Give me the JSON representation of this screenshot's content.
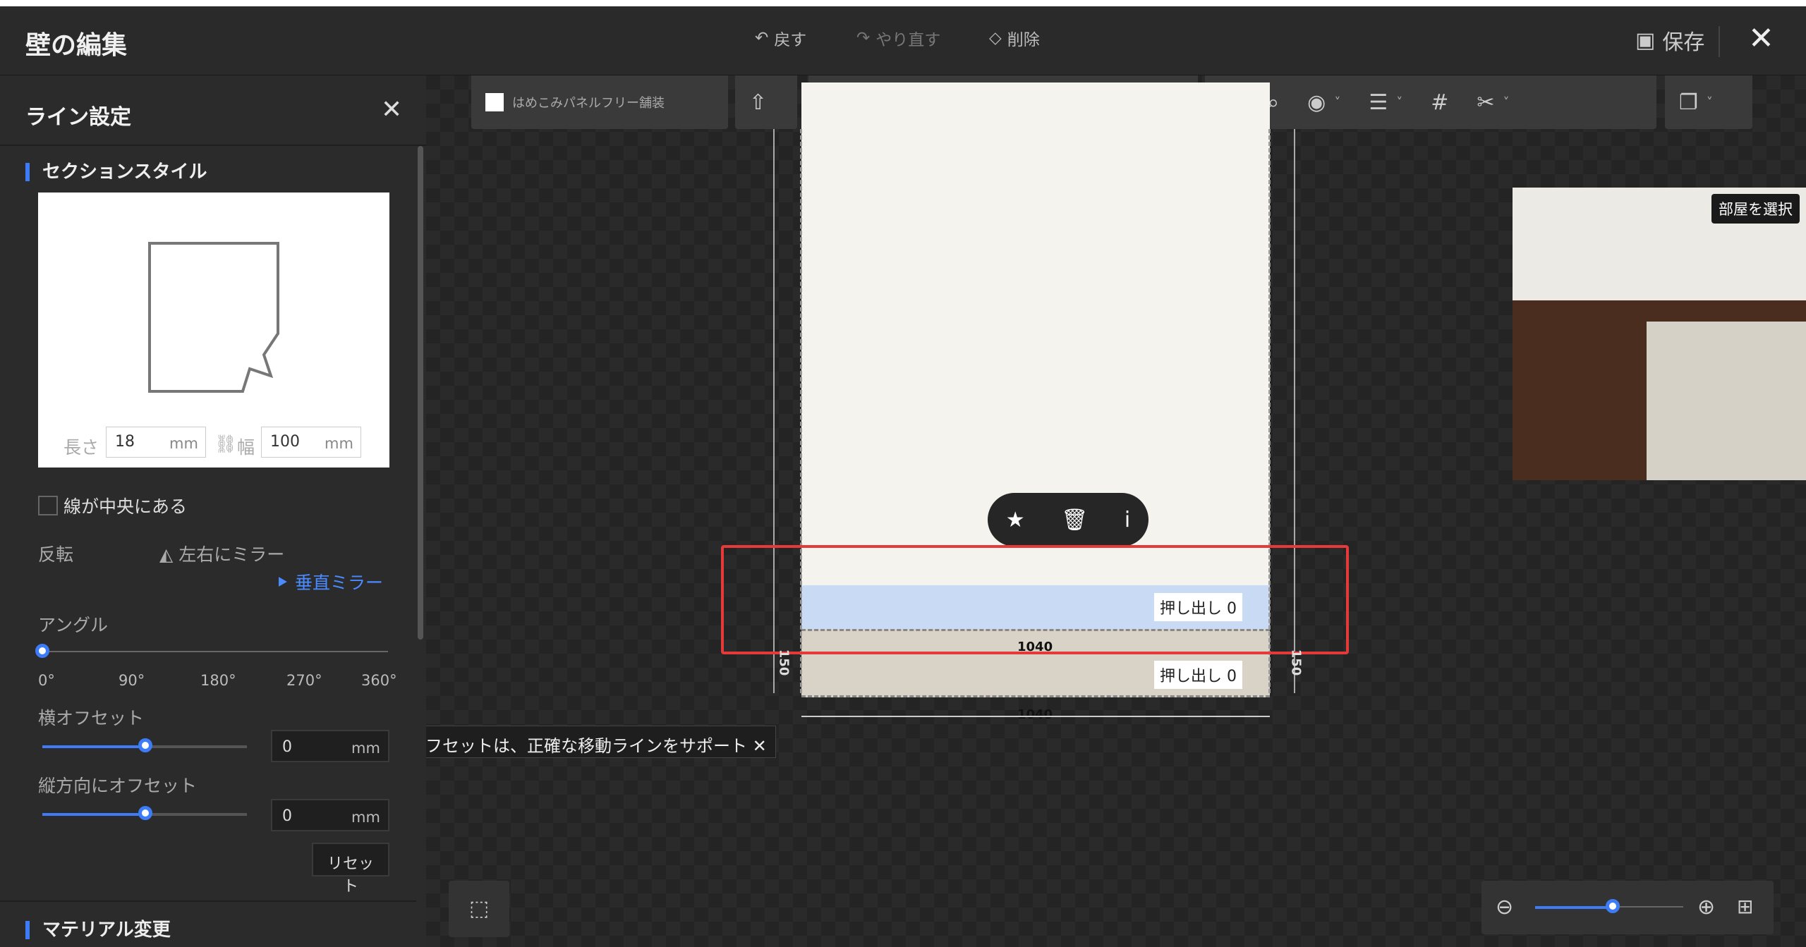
{
  "header": {
    "title": "壁の編集",
    "undo": "戻す",
    "redo": "やり直す",
    "delete": "削除",
    "save": "保存"
  },
  "panel": {
    "title": "ライン設定",
    "section_style": "セクションスタイル",
    "length_label": "長さ",
    "length_value": "18",
    "width_label": "幅",
    "width_value": "100",
    "unit": "mm",
    "center_line": "線が中央にある",
    "flip": "反転",
    "mirror_h": "左右にミラー",
    "mirror_v": "垂直ミラー",
    "angle": "アングル",
    "angle_ticks": [
      "0°",
      "90°",
      "180°",
      "270°",
      "360°"
    ],
    "h_offset": "横オフセット",
    "h_offset_value": "0",
    "v_offset": "縦方向にオフセット",
    "v_offset_value": "0",
    "reset": "リセット",
    "material": "マテリアル変更"
  },
  "toolbar": {
    "panel_free": "はめこみパネルフリー舗装"
  },
  "canvas": {
    "extrude_label": "押し出し",
    "extrude_value_1": "0",
    "extrude_value_2": "0",
    "dim_width_inner": "1040",
    "dim_width_outer": "1040",
    "dim_height_left": "150",
    "dim_height_right": "150",
    "tooltip": "オフセットは、正確な移動ラインをサポート",
    "room_select": "部屋を選択"
  }
}
